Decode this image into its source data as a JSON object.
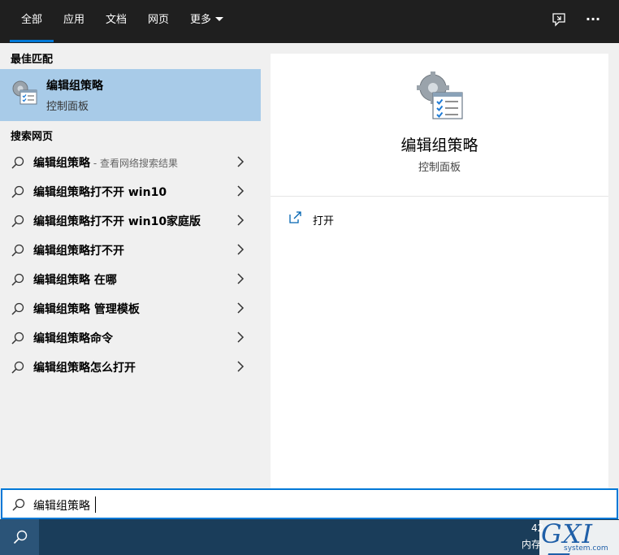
{
  "nav": {
    "tabs": [
      {
        "label": "全部",
        "active": true
      },
      {
        "label": "应用"
      },
      {
        "label": "文档"
      },
      {
        "label": "网页"
      },
      {
        "label": "更多"
      }
    ],
    "feedback_icon": "feedback-icon",
    "more_options_icon": "ellipsis-icon",
    "more_options_glyph": "···"
  },
  "results": {
    "best_match_header": "最佳匹配",
    "best_match": {
      "title": "编辑组策略",
      "subtitle": "控制面板",
      "icon": "group-policy-settings-icon"
    },
    "web_header": "搜索网页",
    "web_items": [
      {
        "label": "编辑组策略",
        "suffix": " - 查看网络搜索结果"
      },
      {
        "label": "编辑组策略打不开 win10"
      },
      {
        "label": "编辑组策略打不开 win10家庭版"
      },
      {
        "label": "编辑组策略打不开"
      },
      {
        "label": "编辑组策略 在哪"
      },
      {
        "label": "编辑组策略 管理模板"
      },
      {
        "label": "编辑组策略命令"
      },
      {
        "label": "编辑组策略怎么打开"
      }
    ]
  },
  "detail": {
    "title": "编辑组策略",
    "subtitle": "控制面板",
    "actions": [
      {
        "label": "打开",
        "icon": "open-external-icon"
      }
    ]
  },
  "search": {
    "query": "编辑组策略"
  },
  "taskbar": {
    "tray_line1": "42",
    "tray_line2": "内存"
  },
  "watermark": {
    "text": "GXI网",
    "subtext": "system.com"
  },
  "colors": {
    "accent": "#0078d7",
    "selected_bg": "#a8cbe8",
    "topbar_bg": "#1f1f1f",
    "taskbar_bg": "#1a3d5a"
  }
}
